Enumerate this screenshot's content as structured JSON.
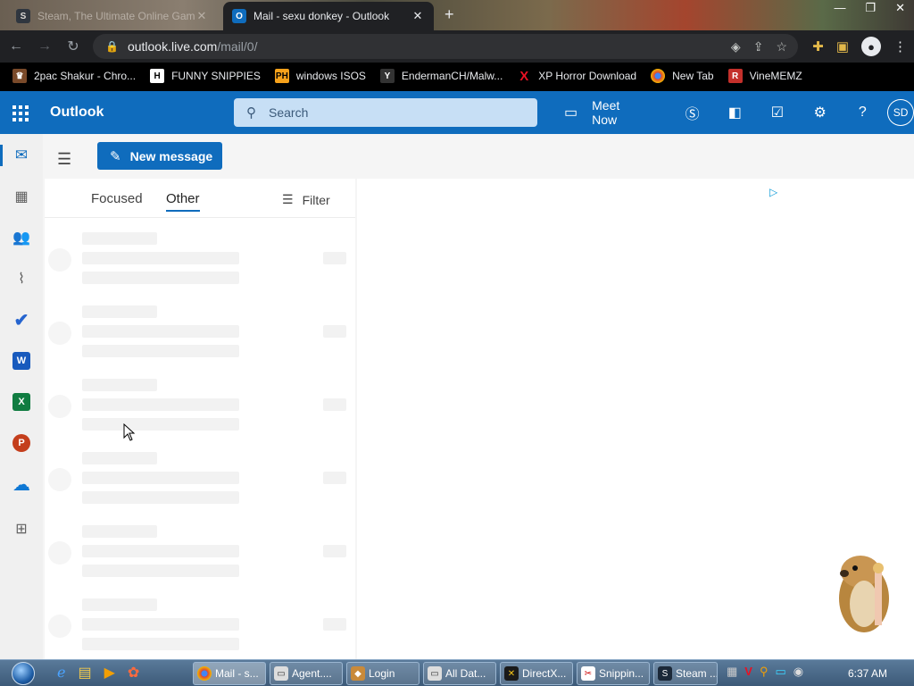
{
  "browser": {
    "tabs": [
      {
        "title": "Steam, The Ultimate Online Game",
        "active": false
      },
      {
        "title": "Mail - sexu donkey - Outlook",
        "active": true
      }
    ],
    "url_host": "outlook.live.com",
    "url_path": "/mail/0/",
    "bookmarks": [
      {
        "label": "2pac Shakur - Chro...",
        "icon": "tupac-icon"
      },
      {
        "label": "FUNNY SNIPPIES",
        "icon": "h-icon"
      },
      {
        "label": "windows ISOS",
        "icon": "ph-icon"
      },
      {
        "label": "EndermanCH/Malw...",
        "icon": "github-icon"
      },
      {
        "label": "XP Horror Download",
        "icon": "x-icon"
      },
      {
        "label": "New Tab",
        "icon": "chrome-icon"
      },
      {
        "label": "VineMEMZ",
        "icon": "r-icon"
      }
    ]
  },
  "outlook": {
    "brand": "Outlook",
    "search_placeholder": "Search",
    "meet_now": "Meet Now",
    "avatar_initials": "SD",
    "new_message": "New message",
    "tabs": {
      "focused": "Focused",
      "other": "Other"
    },
    "filter": "Filter"
  },
  "taskbar": {
    "items": [
      {
        "label": "Mail - s...",
        "active": true
      },
      {
        "label": "Agent....",
        "active": false
      },
      {
        "label": "Login",
        "active": false
      },
      {
        "label": "All Dat...",
        "active": false
      },
      {
        "label": "DirectX...",
        "active": false
      },
      {
        "label": "Snippin...",
        "active": false
      },
      {
        "label": "Steam ...",
        "active": false
      }
    ],
    "clock": "6:37 AM"
  },
  "colors": {
    "outlook_blue": "#0f6cbd",
    "chrome_dark": "#202124"
  }
}
